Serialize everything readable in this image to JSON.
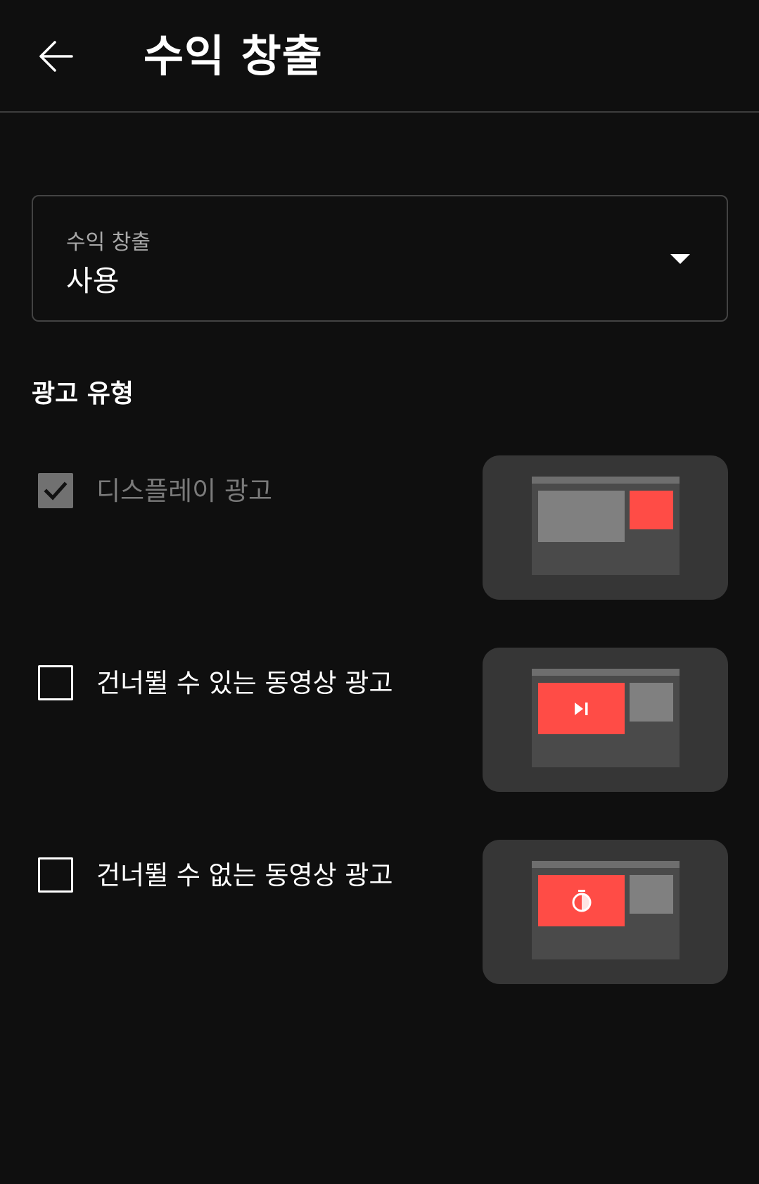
{
  "header": {
    "back_icon": "arrow-left-icon",
    "title": "수익 창출"
  },
  "monetization": {
    "label": "수익 창출",
    "value": "사용",
    "icon": "dropdown-caret-icon"
  },
  "ad_types": {
    "title": "광고 유형",
    "items": [
      {
        "label": "디스플레이 광고",
        "checked": true,
        "disabled": true,
        "preview_icon": "display-ad-preview"
      },
      {
        "label": "건너뛸 수 있는 동영상 광고",
        "checked": false,
        "disabled": false,
        "preview_icon": "skip-next-icon"
      },
      {
        "label": "건너뛸 수 없는 동영상 광고",
        "checked": false,
        "disabled": false,
        "preview_icon": "timer-icon"
      }
    ]
  },
  "colors": {
    "background": "#0f0f0f",
    "card": "#363636",
    "accent_red": "#ff4c46",
    "muted_text": "#7a7a7a"
  }
}
